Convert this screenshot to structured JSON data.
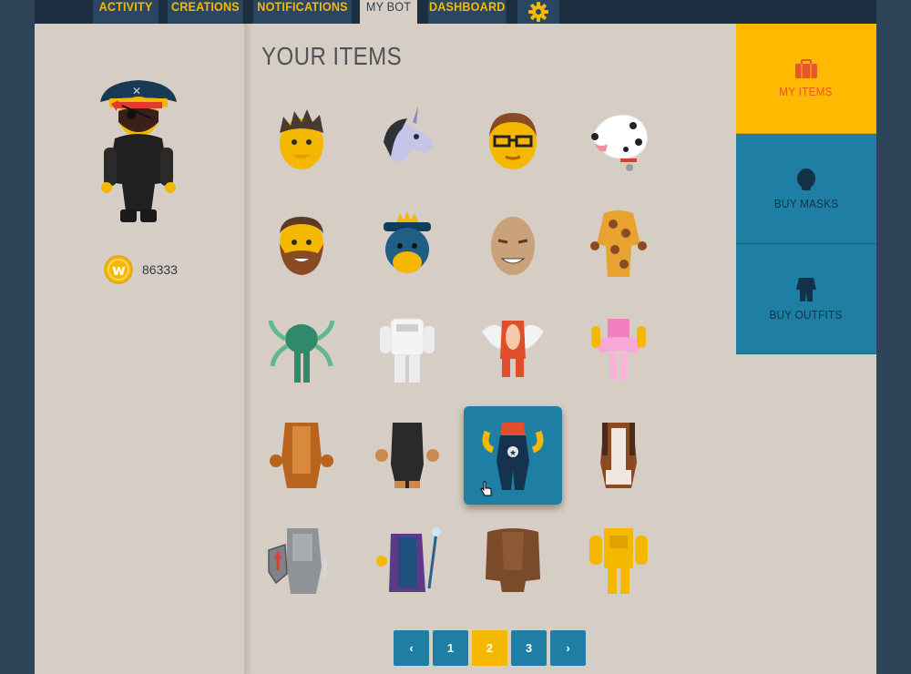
{
  "nav": {
    "tabs": [
      {
        "label": "ACTIVITY"
      },
      {
        "label": "CREATIONS"
      },
      {
        "label": "NOTIFICATIONS"
      },
      {
        "label": "MY BOT"
      },
      {
        "label": "DASHBOARD"
      }
    ],
    "settings_icon": "gear-icon",
    "active_tab": "MY BOT"
  },
  "profile": {
    "avatar": "pirate-gorilla-bot",
    "coins": "86333",
    "coin_icon": "coin-w-icon"
  },
  "main": {
    "title": "YOUR ITEMS",
    "items": [
      {
        "name": "spiky-hair-mask"
      },
      {
        "name": "unicorn-mask"
      },
      {
        "name": "glasses-man-mask"
      },
      {
        "name": "dalmatian-mask"
      },
      {
        "name": "bearded-man-mask"
      },
      {
        "name": "blue-king-mask"
      },
      {
        "name": "bald-man-mask"
      },
      {
        "name": "giraffe-outfit"
      },
      {
        "name": "green-octopus-outfit"
      },
      {
        "name": "astronaut-outfit"
      },
      {
        "name": "red-dragon-outfit"
      },
      {
        "name": "pink-ballerina-outfit"
      },
      {
        "name": "lion-outfit"
      },
      {
        "name": "black-dog-outfit"
      },
      {
        "name": "sheriff-outfit"
      },
      {
        "name": "beagle-outfit"
      },
      {
        "name": "knight-armor-outfit"
      },
      {
        "name": "wizard-outfit"
      },
      {
        "name": "bigfoot-outfit"
      },
      {
        "name": "gold-robot-outfit"
      }
    ],
    "selected_item": "sheriff-outfit"
  },
  "pagination": {
    "prev": "‹",
    "pages": [
      "1",
      "2",
      "3"
    ],
    "current": "2",
    "next": "›"
  },
  "sidebar": {
    "buttons": [
      {
        "label": "MY ITEMS",
        "icon": "bag-icon"
      },
      {
        "label": "BUY MASKS",
        "icon": "mask-icon"
      },
      {
        "label": "BUY OUTFITS",
        "icon": "outfit-icon"
      }
    ]
  },
  "colors": {
    "accent": "#f5b800",
    "teal": "#1f7ea4",
    "navy": "#2e4459",
    "background": "#d6cec4"
  }
}
